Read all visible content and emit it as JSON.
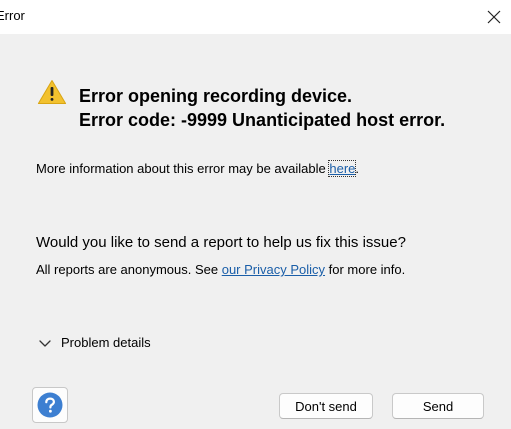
{
  "window": {
    "title": "Error"
  },
  "error": {
    "heading_line1": "Error opening recording device.",
    "heading_line2": "Error code: -9999 Unanticipated host error.",
    "info_text": "More information about this error may be available ",
    "info_link": "here",
    "info_suffix": "."
  },
  "report": {
    "question": "Would you like to send a report to help us fix this issue?",
    "anon_prefix": "All reports are anonymous. See ",
    "privacy_link": "our Privacy Policy",
    "anon_suffix": " for more info."
  },
  "details": {
    "label": "Problem details"
  },
  "buttons": {
    "dont_send": "Don't send",
    "send": "Send"
  },
  "colors": {
    "link": "#1a5ea8",
    "warning": "#f2c12e",
    "help": "#3d7fd1"
  },
  "icons": {
    "warning": "warning-icon",
    "close": "close-icon",
    "chevron": "chevron-down-icon",
    "help": "help-icon"
  }
}
